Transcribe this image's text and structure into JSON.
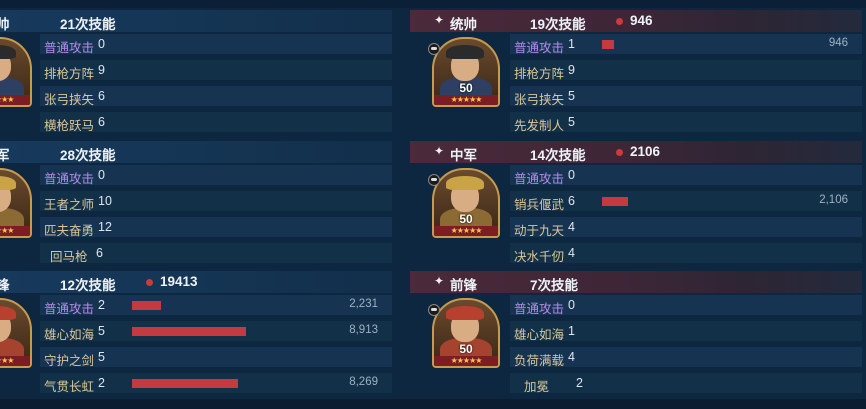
{
  "left": {
    "groups": [
      {
        "role": "帅",
        "count": "21次技能",
        "damage": "",
        "skills": [
          {
            "name": "普通攻击",
            "num": "0",
            "value": "",
            "ratio": 0,
            "basic": true
          },
          {
            "name": "排枪方阵",
            "num": "9",
            "value": "",
            "ratio": 0
          },
          {
            "name": "张弓挟矢",
            "num": "6",
            "value": "",
            "ratio": 0
          },
          {
            "name": "横枪跃马",
            "num": "6",
            "value": "",
            "ratio": 0
          }
        ]
      },
      {
        "role": "军",
        "count": "28次技能",
        "damage": "",
        "skills": [
          {
            "name": "普通攻击",
            "num": "0",
            "value": "",
            "ratio": 0,
            "basic": true
          },
          {
            "name": "王者之师",
            "num": "10",
            "value": "",
            "ratio": 0
          },
          {
            "name": "匹夫奋勇",
            "num": "12",
            "value": "",
            "ratio": 0
          },
          {
            "name": "回马枪",
            "num": "6",
            "value": "",
            "ratio": 0
          }
        ]
      },
      {
        "role": "锋",
        "count": "12次技能",
        "damage": "19413",
        "skills": [
          {
            "name": "普通攻击",
            "num": "2",
            "value": "2,231",
            "ratio": 0.25,
            "basic": true
          },
          {
            "name": "雄心如海",
            "num": "5",
            "value": "8,913",
            "ratio": 1.0
          },
          {
            "name": "守护之剑",
            "num": "5",
            "value": "",
            "ratio": 0
          },
          {
            "name": "气贯长虹",
            "num": "2",
            "value": "8,269",
            "ratio": 0.93
          }
        ]
      }
    ]
  },
  "right": {
    "groups": [
      {
        "role": "统帅",
        "count": "19次技能",
        "damage": "946",
        "level": "50",
        "skills": [
          {
            "name": "普通攻击",
            "num": "1",
            "value": "946",
            "ratio": 0.11,
            "basic": true
          },
          {
            "name": "排枪方阵",
            "num": "9",
            "value": "",
            "ratio": 0
          },
          {
            "name": "张弓挟矢",
            "num": "5",
            "value": "",
            "ratio": 0
          },
          {
            "name": "先发制人",
            "num": "5",
            "value": "",
            "ratio": 0
          }
        ]
      },
      {
        "role": "中军",
        "count": "14次技能",
        "damage": "2106",
        "level": "50",
        "skills": [
          {
            "name": "普通攻击",
            "num": "0",
            "value": "",
            "ratio": 0,
            "basic": true
          },
          {
            "name": "销兵偃武",
            "num": "6",
            "value": "2,106",
            "ratio": 0.24
          },
          {
            "name": "动于九天",
            "num": "4",
            "value": "",
            "ratio": 0
          },
          {
            "name": "决水千仞",
            "num": "4",
            "value": "",
            "ratio": 0
          }
        ]
      },
      {
        "role": "前锋",
        "count": "7次技能",
        "damage": "",
        "level": "50",
        "skills": [
          {
            "name": "普通攻击",
            "num": "0",
            "value": "",
            "ratio": 0,
            "basic": true
          },
          {
            "name": "雄心如海",
            "num": "1",
            "value": "",
            "ratio": 0
          },
          {
            "name": "负荷满载",
            "num": "4",
            "value": "",
            "ratio": 0
          },
          {
            "name": "加冕",
            "num": "2",
            "value": "",
            "ratio": 0
          }
        ]
      }
    ]
  },
  "stars": "★★★★★",
  "colors": {
    "bar": "#c53a41",
    "basic_skill": "#b48ae8",
    "skill": "#d9c79a"
  }
}
